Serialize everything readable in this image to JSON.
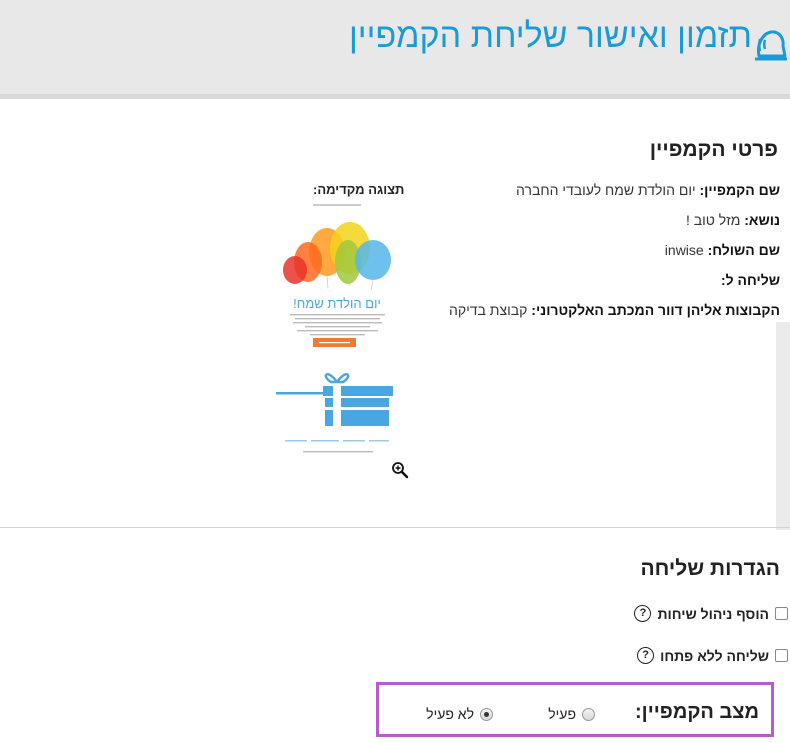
{
  "header": {
    "title": "תזמון ואישור שליחת הקמפיין",
    "icon": "bell-icon"
  },
  "campaign_details": {
    "title": "פרטי הקמפיין",
    "name_label": "שם הקמפיין:",
    "name_value": "יום הולדת שמח לעובדי החברה",
    "subject_label": "נושא:",
    "subject_value": "מזל טוב !",
    "sender_label": "שם השולח:",
    "sender_value": "inwise",
    "send_to_label": "שליחה ל:",
    "groups_label": "הקבוצות אליהן דוור המכתב האלקטרוני:",
    "groups_value": "קבוצת בדיקה",
    "preview_label": "תצוגה מקדימה:"
  },
  "preview": {
    "headline": "יום הולדת שמח!",
    "button_color": "#f07a2e",
    "gift_color": "#4aa6e0"
  },
  "send_settings": {
    "title": "הגדרות שליחה",
    "options": [
      {
        "label": "הוסף ניהול שיחות",
        "checked": false
      },
      {
        "label": "שליחה ללא פתחו",
        "checked": false
      }
    ]
  },
  "campaign_status": {
    "title": "מצב הקמפיין:",
    "active_label": "פעיל",
    "inactive_label": "לא פעיל",
    "selected": "לא פעיל",
    "highlight_color": "#b85cc9"
  }
}
